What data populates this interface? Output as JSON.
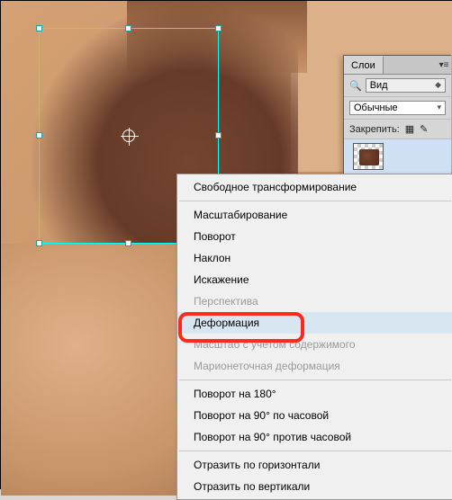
{
  "layers_panel": {
    "tab_label": "Слои",
    "view_label": "Вид",
    "blend_mode": "Обычные",
    "lock_label": "Закрепить:"
  },
  "context_menu": {
    "free_transform": "Свободное трансформирование",
    "scale": "Масштабирование",
    "rotate": "Поворот",
    "skew": "Наклон",
    "distort": "Искажение",
    "perspective": "Перспектива",
    "warp": "Деформация",
    "content_aware_scale": "Масштаб с учетом содержимого",
    "puppet_warp": "Марионеточная деформация",
    "rotate_180": "Поворот на 180°",
    "rotate_90_cw": "Поворот на 90° по часовой",
    "rotate_90_ccw": "Поворот на 90° против часовой",
    "flip_h": "Отразить по горизонтали",
    "flip_v": "Отразить по вертикали"
  }
}
